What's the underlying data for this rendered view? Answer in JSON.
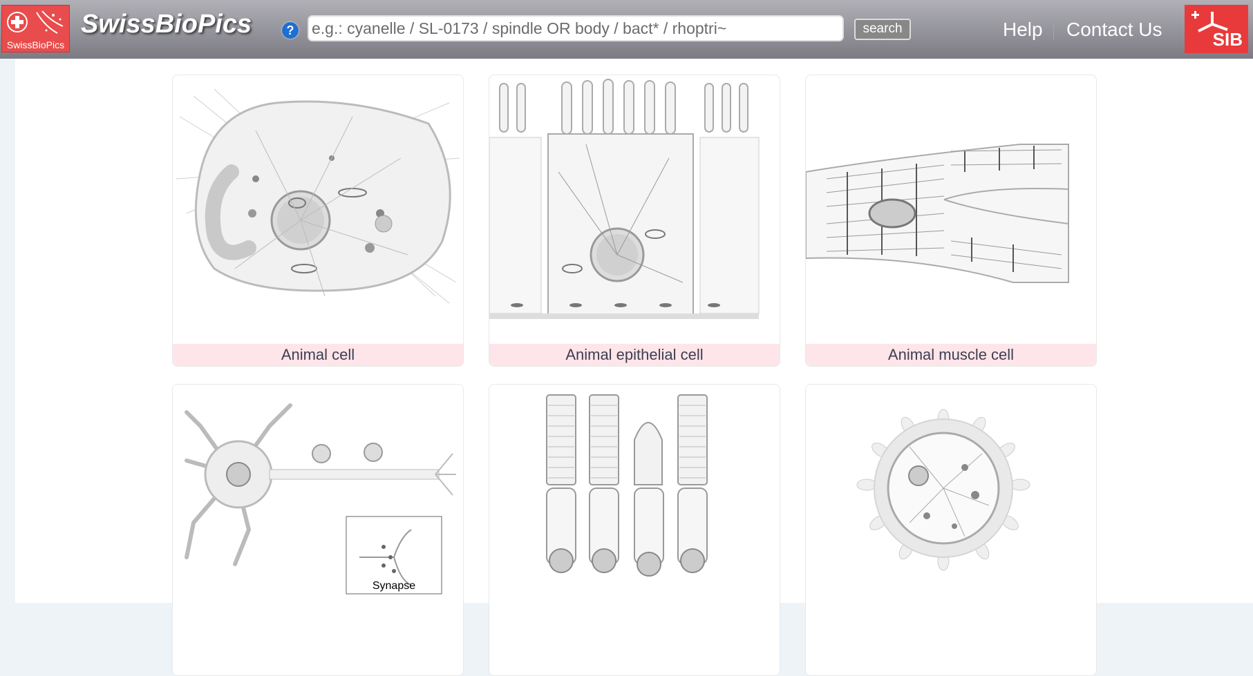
{
  "header": {
    "logo_caption": "SwissBioPics",
    "brand": "SwissBioPics",
    "help_icon": "?",
    "search_placeholder": "e.g.: cyanelle / SL-0173 / spindle OR body / bact* / rhoptri~",
    "search_button": "search",
    "nav_help": "Help",
    "nav_contact": "Contact Us",
    "sib_logo": "SIB"
  },
  "cards": [
    {
      "label": "Animal cell"
    },
    {
      "label": "Animal epithelial cell"
    },
    {
      "label": "Animal muscle cell"
    },
    {
      "label": ""
    },
    {
      "label": ""
    },
    {
      "label": ""
    }
  ],
  "inset_label": "Synapse",
  "colors": {
    "header_gradient_top": "#b0b0b6",
    "header_gradient_bottom": "#7c7b84",
    "caption_bg": "#fde5e9",
    "logo_red": "#e84c4c",
    "help_icon_blue": "#1e6fd0"
  }
}
